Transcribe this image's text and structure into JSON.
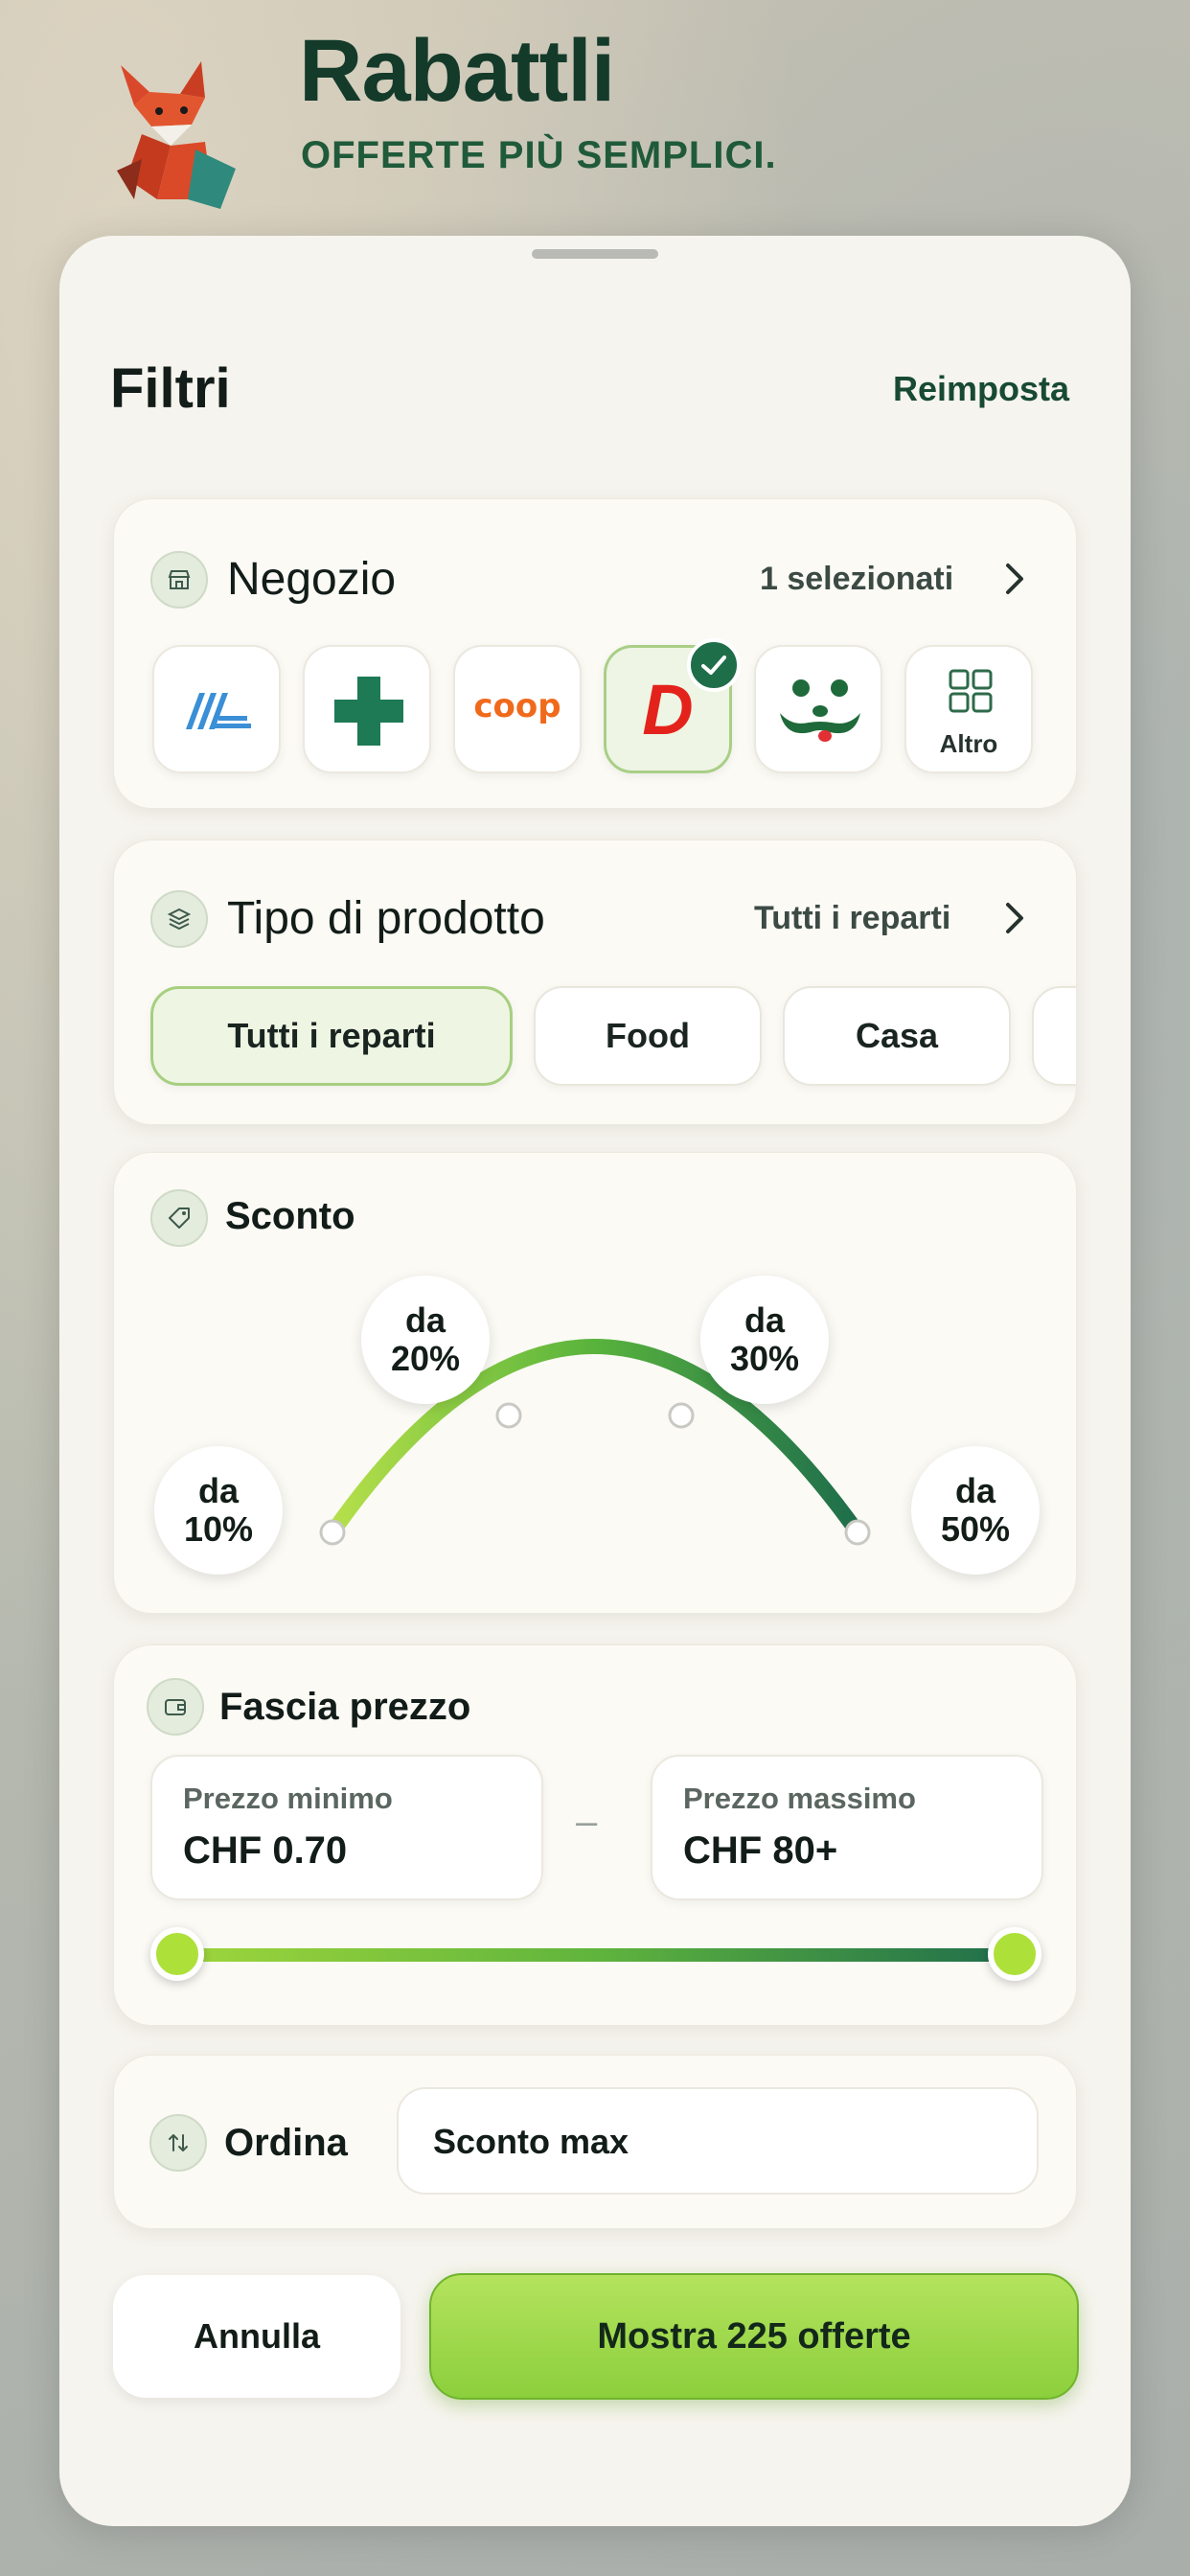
{
  "brand": {
    "name": "Rabattli",
    "tagline": "OFFERTE PIÙ SEMPLICI."
  },
  "sheet": {
    "title": "Filtri",
    "reset_label": "Reimposta"
  },
  "store": {
    "title": "Negozio",
    "summary": "1 selezionati",
    "icon": "store-icon",
    "tiles": [
      {
        "id": "aldi",
        "icon": "aldi-logo-icon",
        "selected": false
      },
      {
        "id": "pharmacy",
        "icon": "green-cross-icon",
        "selected": false
      },
      {
        "id": "coop",
        "logo_text": "coop",
        "selected": false
      },
      {
        "id": "denner",
        "logo_text": "D",
        "selected": true
      },
      {
        "id": "pet",
        "icon": "dog-face-icon",
        "selected": false
      },
      {
        "id": "more",
        "label": "Altro",
        "icon": "grid-icon",
        "selected": false
      }
    ]
  },
  "product_type": {
    "title": "Tipo di prodotto",
    "summary": "Tutti i reparti",
    "icon": "layers-icon",
    "chips": [
      {
        "label": "Tutti i reparti",
        "active": true
      },
      {
        "label": "Food",
        "active": false
      },
      {
        "label": "Casa",
        "active": false
      }
    ]
  },
  "discount": {
    "title": "Sconto",
    "icon": "tag-icon",
    "stops": [
      {
        "line1": "da",
        "line2": "10%"
      },
      {
        "line1": "da",
        "line2": "20%"
      },
      {
        "line1": "da",
        "line2": "30%"
      },
      {
        "line1": "da",
        "line2": "50%"
      }
    ]
  },
  "price": {
    "title": "Fascia prezzo",
    "icon": "wallet-icon",
    "min_label": "Prezzo minimo",
    "min_value": "CHF 0.70",
    "max_label": "Prezzo massimo",
    "max_value": "CHF 80+",
    "separator": "–",
    "range_low": 0,
    "range_high": 1
  },
  "sort": {
    "title": "Ordina",
    "icon": "sort-arrows-icon",
    "value": "Sconto max"
  },
  "actions": {
    "cancel_label": "Annulla",
    "apply_label": "Mostra 225 offerte"
  },
  "colors": {
    "accent_dark": "#1f6e4a",
    "accent_light": "#9fdc3c",
    "text": "#121c18"
  }
}
